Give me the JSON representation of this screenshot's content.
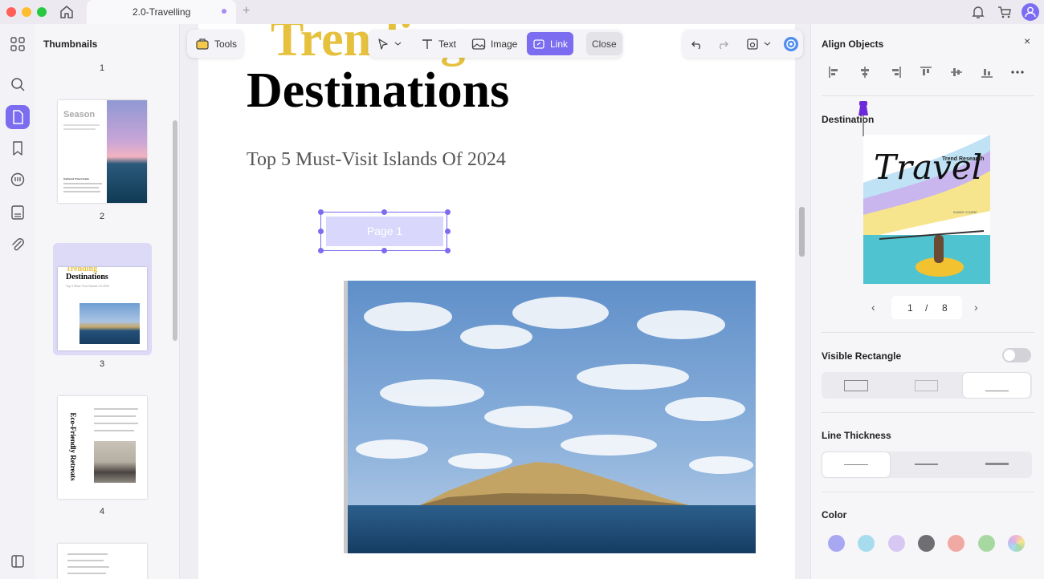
{
  "titlebar": {
    "tab_title": "2.0-Travelling",
    "new_tab": "+"
  },
  "thumbnails": {
    "title": "Thumbnails",
    "pages": [
      {
        "number": "1"
      },
      {
        "number": "2",
        "heading": "Season",
        "footer_title": "Gathered Travel Guide"
      },
      {
        "number": "3",
        "heading_top": "Trending",
        "heading": "Destinations",
        "subtitle": "Top 5 Must-Visit Islands Of 2024"
      },
      {
        "number": "4",
        "vertical_title": "Eco-Friendly Retreats"
      },
      {
        "number": ""
      }
    ]
  },
  "toolbar": {
    "tools": "Tools",
    "text": "Text",
    "image": "Image",
    "link": "Link",
    "close": "Close"
  },
  "document": {
    "heading_top": "Trending",
    "heading": "Destinations",
    "subtitle": "Top 5 Must-Visit Islands Of 2024",
    "link_label": "Page 1"
  },
  "right_panel": {
    "align_title": "Align Objects",
    "close": "×",
    "destination_label": "Destination",
    "cover": {
      "brand": "Trend Research",
      "title": "Travel",
      "small_caption": "SUMMIT COURSE"
    },
    "pager": {
      "current": "1",
      "separator": "/",
      "total": "8",
      "prev": "‹",
      "next": "›"
    },
    "visible_rectangle_label": "Visible Rectangle",
    "visible_rectangle_on": false,
    "line_thickness_label": "Line Thickness",
    "color_label": "Color",
    "colors": [
      "#a8a8f2",
      "#a6dcee",
      "#d8c7f2",
      "#6f6f73",
      "#f0a9a2",
      "#a8d8a2",
      "#f4b4d0"
    ]
  }
}
